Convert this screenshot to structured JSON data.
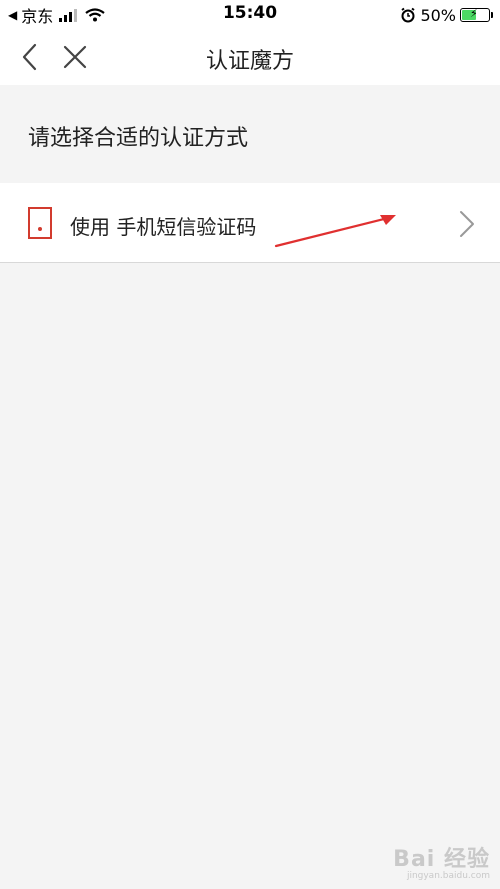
{
  "status_bar": {
    "carrier": "京东",
    "time": "15:40",
    "battery_percent": "50%"
  },
  "nav": {
    "title": "认证魔方"
  },
  "section": {
    "title": "请选择合适的认证方式"
  },
  "options": [
    {
      "label": "使用 手机短信验证码",
      "icon": "phone-icon"
    }
  ],
  "watermark": {
    "brand": "Bai 经验",
    "url": "jingyan.baidu.com"
  },
  "colors": {
    "accent": "#d23b2e",
    "background": "#f4f4f4",
    "battery": "#4cd964"
  }
}
